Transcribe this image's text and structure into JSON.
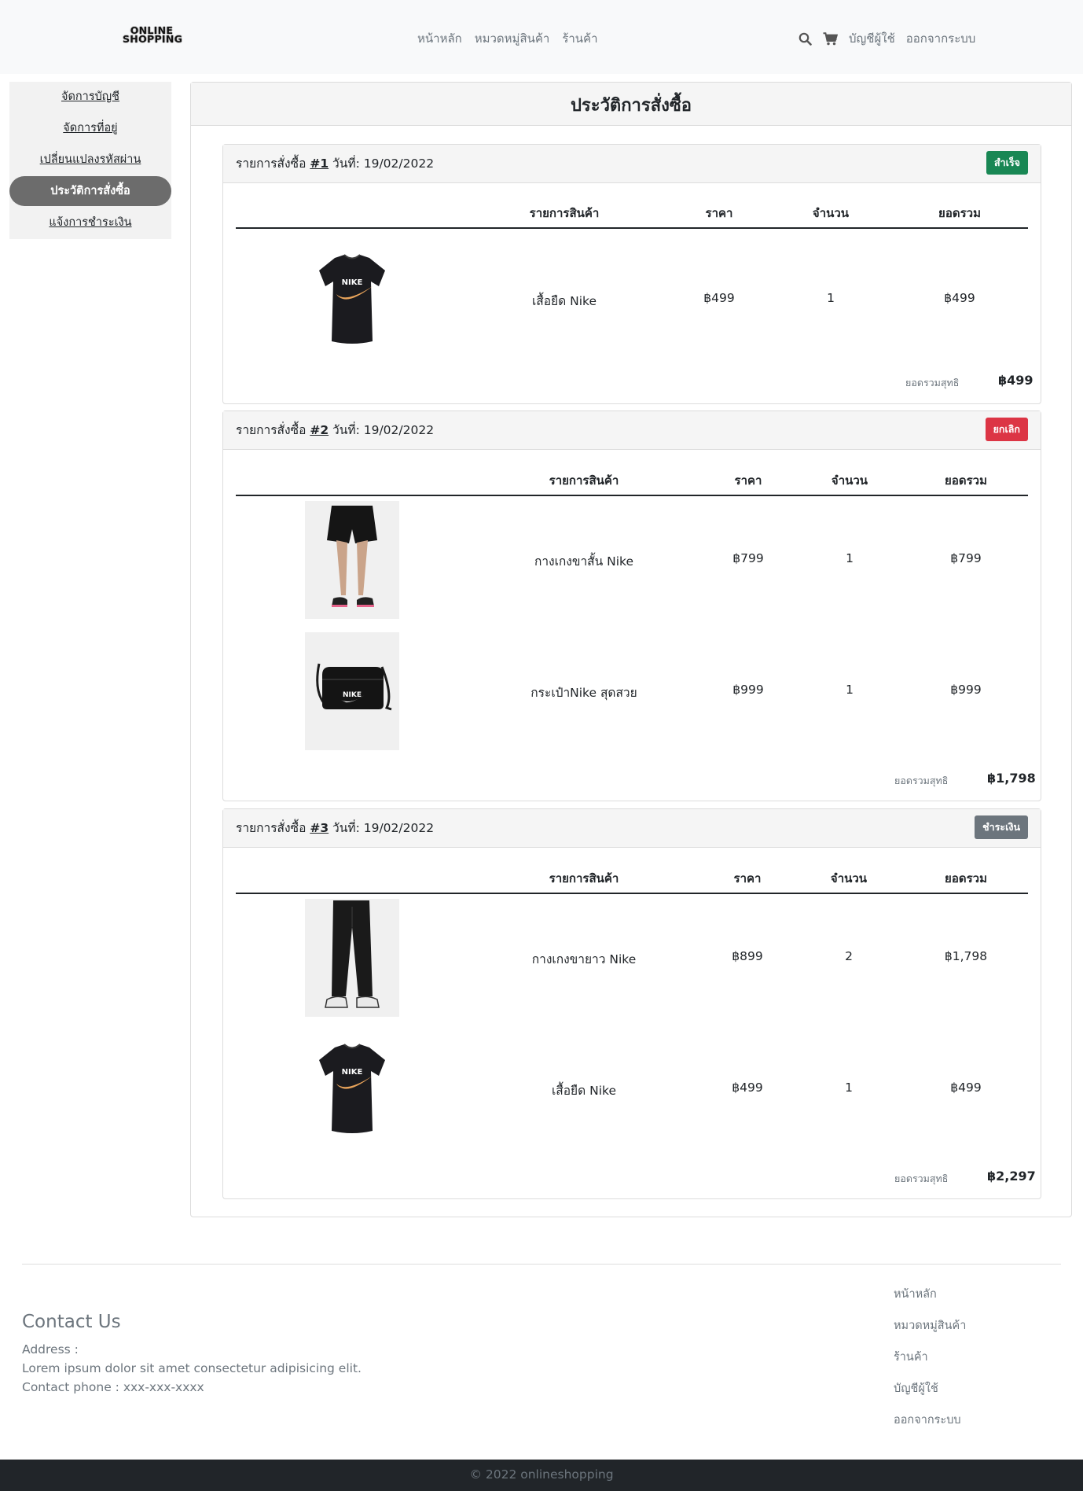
{
  "navbar": {
    "logo_line1": "ONLINE",
    "logo_line2": "SHOPPING",
    "links": [
      "หน้าหลัก",
      "หมวดหมู่สินค้า",
      "ร้านค้า"
    ],
    "right_links": [
      "บัญชีผู้ใช้",
      "ออกจากระบบ"
    ],
    "icons": [
      "search-icon",
      "cart-icon"
    ]
  },
  "sidebar": {
    "items": [
      {
        "label": "จัดการบัญชี",
        "active": false
      },
      {
        "label": "จัดการที่อยู่",
        "active": false
      },
      {
        "label": "เปลี่ยนแปลงรหัสผ่าน",
        "active": false
      },
      {
        "label": "ประวัติการสั่งซื้อ",
        "active": true
      },
      {
        "label": "แจ้งการชำระเงิน",
        "active": false
      }
    ]
  },
  "main": {
    "title": "ประวัติการสั่งซื้อ"
  },
  "table_headers": {
    "product": "รายการสินค้า",
    "price": "ราคา",
    "qty": "จำนวน",
    "total": "ยอดรวม"
  },
  "total_label": "ยอดรวมสุทธิ",
  "orders": [
    {
      "prefix": "รายการสั่งซื้อ",
      "number": "#1",
      "date_label": "วันที่:",
      "date": "19/02/2022",
      "status": "สำเร็จ",
      "status_color": "#198754",
      "items": [
        {
          "name": "เสื้อยืด Nike",
          "price": "฿499",
          "qty": "1",
          "total": "฿499",
          "image": "tshirt-image"
        }
      ],
      "grand_total": "฿499"
    },
    {
      "prefix": "รายการสั่งซื้อ",
      "number": "#2",
      "date_label": "วันที่:",
      "date": "19/02/2022",
      "status": "ยกเลิก",
      "status_color": "#dc3545",
      "items": [
        {
          "name": "กางเกงขาสั้น Nike",
          "price": "฿799",
          "qty": "1",
          "total": "฿799",
          "image": "shorts-image"
        },
        {
          "name": "กระเป๋าNike สุดสวย",
          "price": "฿999",
          "qty": "1",
          "total": "฿999",
          "image": "bag-image"
        }
      ],
      "grand_total": "฿1,798"
    },
    {
      "prefix": "รายการสั่งซื้อ",
      "number": "#3",
      "date_label": "วันที่:",
      "date": "19/02/2022",
      "status": "ชำระเงิน",
      "status_color": "#6c757d",
      "items": [
        {
          "name": "กางเกงขายาว Nike",
          "price": "฿899",
          "qty": "2",
          "total": "฿1,798",
          "image": "pants-image"
        },
        {
          "name": "เสื้อยืด Nike",
          "price": "฿499",
          "qty": "1",
          "total": "฿499",
          "image": "tshirt-image"
        }
      ],
      "grand_total": "฿2,297"
    }
  ],
  "footer": {
    "contact_title": "Contact Us",
    "address_label": "Address :",
    "address": "Lorem ipsum dolor sit amet consectetur adipisicing elit.",
    "phone": "Contact phone : xxx-xxx-xxxx",
    "links": [
      "หน้าหลัก",
      "หมวดหมู่สินค้า",
      "ร้านค้า",
      "บัญชีผู้ใช้",
      "ออกจากระบบ"
    ],
    "copyright": "© 2022 onlineshopping"
  }
}
